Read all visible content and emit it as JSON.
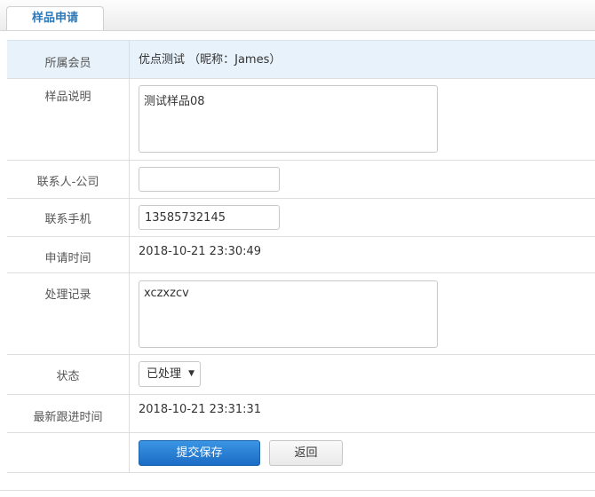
{
  "tab": {
    "label": "样品申请"
  },
  "form": {
    "member": {
      "label": "所属会员",
      "value": "优点测试 （昵称：James）"
    },
    "sample_desc": {
      "label": "样品说明",
      "value": "测试样品08"
    },
    "contact_company": {
      "label": "联系人-公司",
      "value": ""
    },
    "contact_phone": {
      "label": "联系手机",
      "value": "13585732145"
    },
    "apply_time": {
      "label": "申请时间",
      "value": "2018-10-21 23:30:49"
    },
    "process_record": {
      "label": "处理记录",
      "value": "xczxzcv"
    },
    "status": {
      "label": "状态",
      "selected": "已处理",
      "arrow_icon": "caret-down-icon"
    },
    "latest_followup": {
      "label": "最新跟进时间",
      "value": "2018-10-21 23:31:31"
    },
    "buttons": {
      "submit": "提交保存",
      "back": "返回"
    }
  },
  "colors": {
    "accent": "#2f78b5",
    "primary_button": "#1b6cc4",
    "highlight_row": "#e8f2fb"
  }
}
